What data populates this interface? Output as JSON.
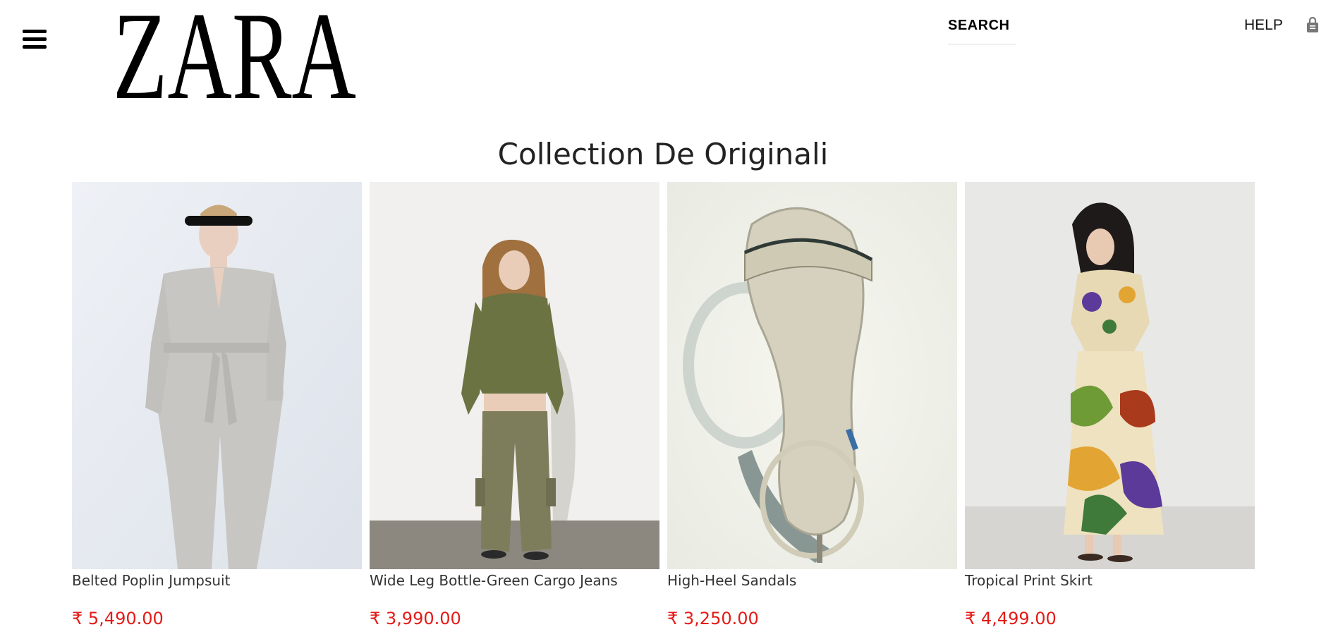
{
  "header": {
    "brand": "ZARA",
    "search_label": "SEARCH",
    "help_label": "HELP",
    "menu_icon": "hamburger-menu-icon",
    "bag_icon": "shopping-bag-icon"
  },
  "collection": {
    "title": "Collection De Originali",
    "products": [
      {
        "name": "Belted Poplin Jumpsuit",
        "price": "₹ 5,490.00"
      },
      {
        "name": "Wide Leg Bottle-Green Cargo Jeans",
        "price": "₹ 3,990.00"
      },
      {
        "name": "High-Heel Sandals",
        "price": "₹ 3,250.00"
      },
      {
        "name": "Tropical Print Skirt",
        "price": "₹ 4,499.00"
      }
    ]
  },
  "colors": {
    "price": "#e41b17",
    "text": "#333333"
  }
}
